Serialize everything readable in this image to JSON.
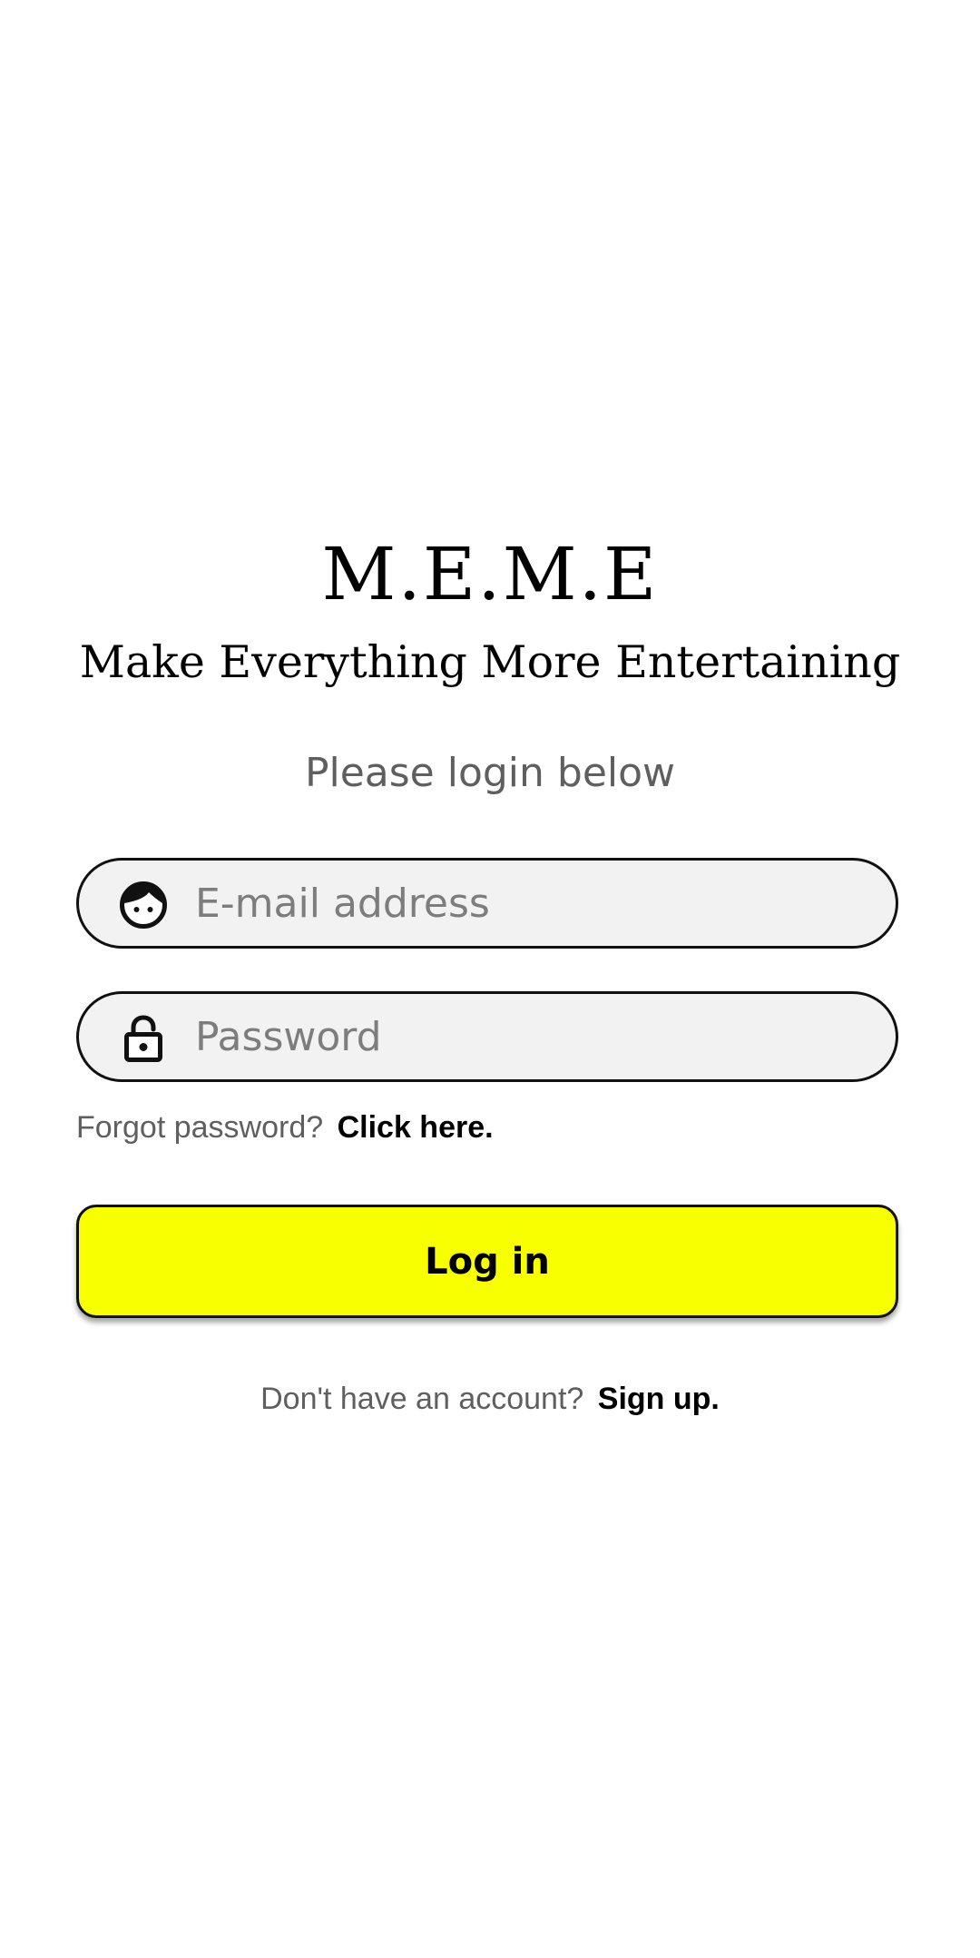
{
  "app": {
    "title": "M.E.M.E",
    "tagline": "Make Everything More Entertaining"
  },
  "login": {
    "prompt": "Please login below",
    "email_placeholder": "E-mail address",
    "email_value": "",
    "email_icon": "face-icon",
    "password_placeholder": "Password",
    "password_value": "",
    "password_icon": "unlocked-padlock-icon",
    "forgot_text": "Forgot password?",
    "forgot_link": "Click here.",
    "login_button": "Log in",
    "signup_text": "Don't have an account?",
    "signup_link": "Sign up."
  },
  "colors": {
    "accent": "#f7ff00",
    "field_background": "#f2f2f2",
    "muted_text": "#5f5f5f"
  }
}
